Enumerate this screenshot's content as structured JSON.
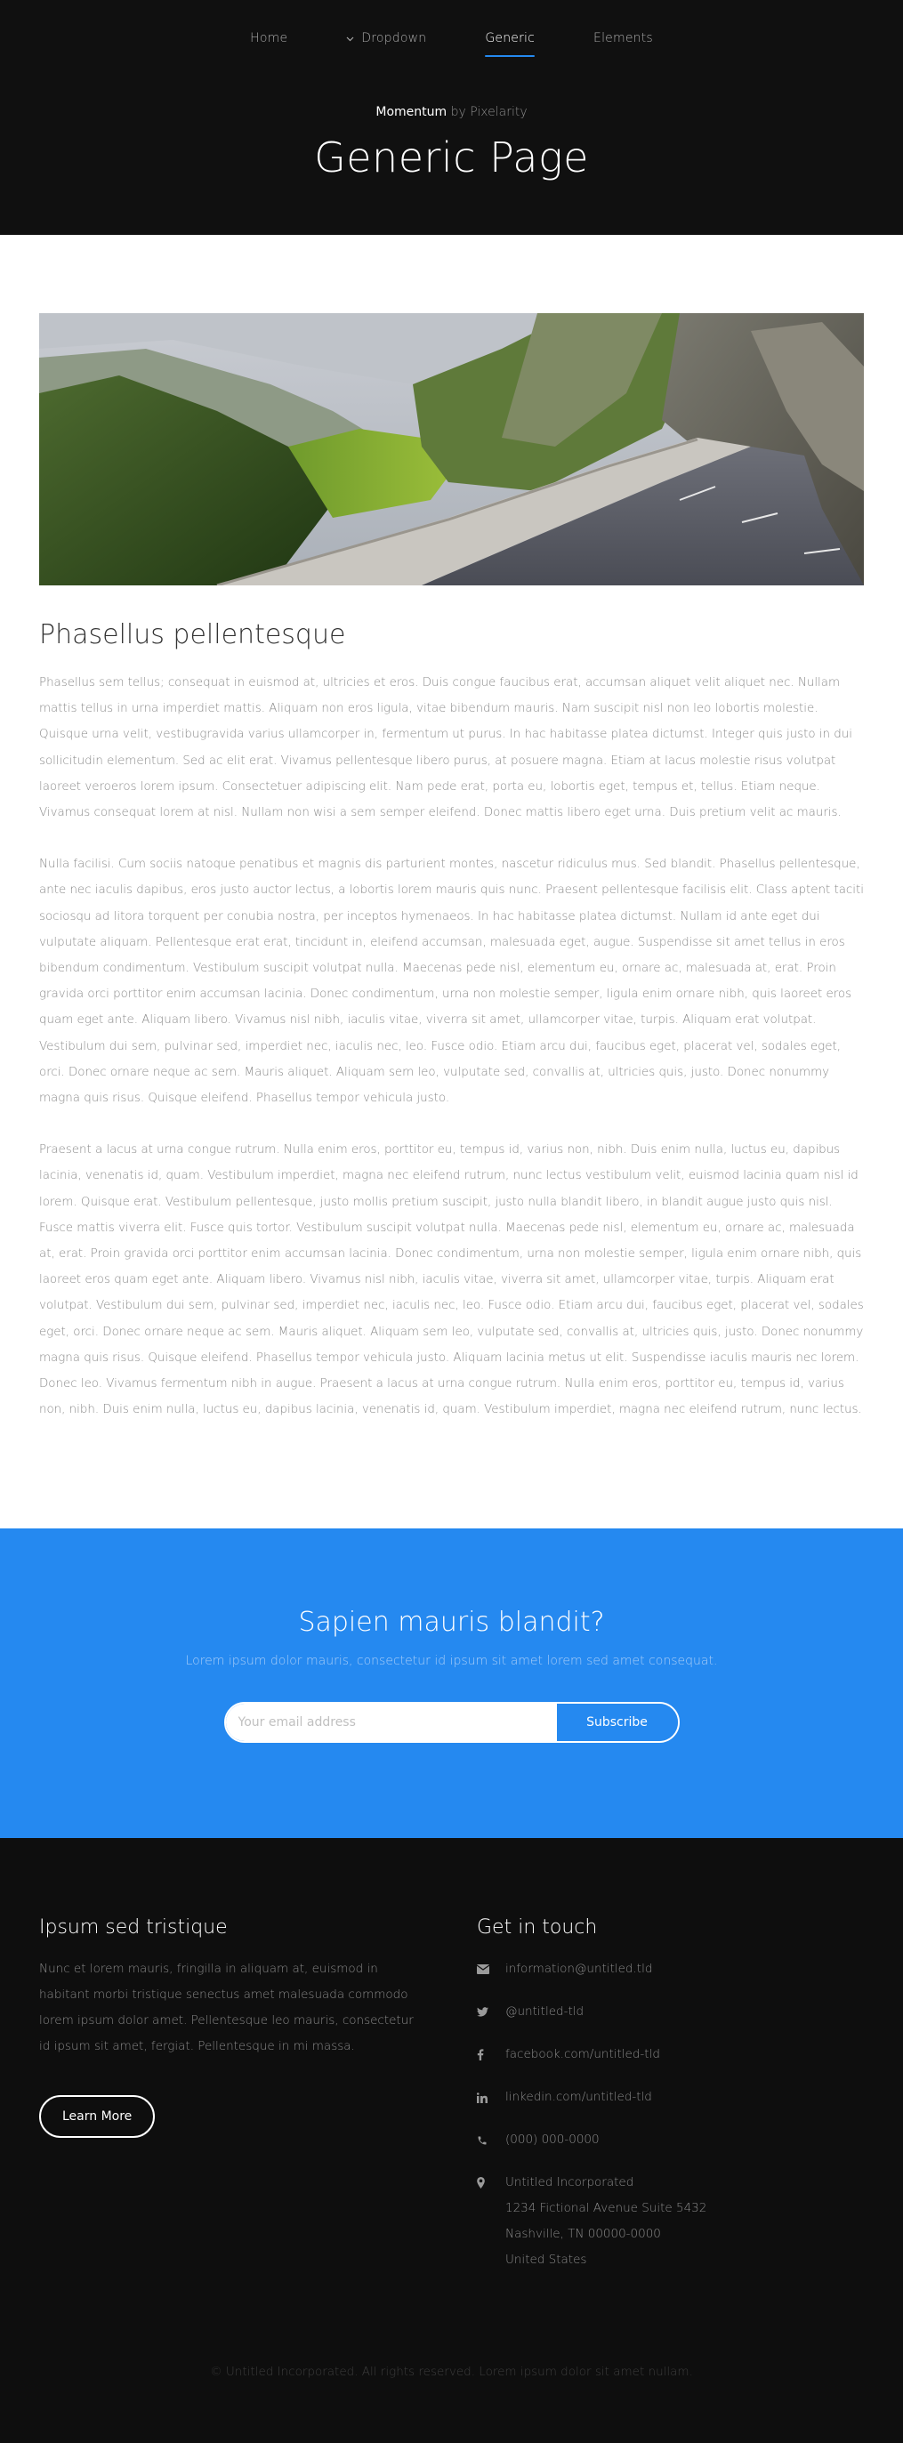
{
  "nav": {
    "items": [
      {
        "label": "Home",
        "active": false
      },
      {
        "label": "Dropdown",
        "active": false,
        "has_chevron": true
      },
      {
        "label": "Generic",
        "active": true
      },
      {
        "label": "Elements",
        "active": false
      }
    ]
  },
  "header": {
    "brand": "Momentum",
    "byline_suffix": "by Pixelarity",
    "title": "Generic Page"
  },
  "main": {
    "image_alt": "mountain road",
    "section_title": "Phasellus pellentesque",
    "paragraphs": [
      "Phasellus sem tellus; consequat in euismod at, ultricies et eros. Duis congue faucibus erat, accumsan aliquet velit aliquet nec. Nullam mattis tellus in urna imperdiet mattis. Aliquam non eros ligula, vitae bibendum mauris. Nam suscipit nisl non leo lobortis molestie. Quisque urna velit, vestibugravida varius ullamcorper in, fermentum ut purus. In hac habitasse platea dictumst. Integer quis justo in dui sollicitudin elementum. Sed ac elit erat. Vivamus pellentesque libero purus, at posuere magna. Etiam at lacus molestie risus volutpat laoreet veroeros lorem ipsum. Consectetuer adipiscing elit. Nam pede erat, porta eu, lobortis eget, tempus et, tellus. Etiam neque. Vivamus consequat lorem at nisl. Nullam non wisi a sem semper eleifend. Donec mattis libero eget urna. Duis pretium velit ac mauris.",
      "Nulla facilisi. Cum sociis natoque penatibus et magnis dis parturient montes, nascetur ridiculus mus. Sed blandit. Phasellus pellentesque, ante nec iaculis dapibus, eros justo auctor lectus, a lobortis lorem mauris quis nunc. Praesent pellentesque facilisis elit. Class aptent taciti sociosqu ad litora torquent per conubia nostra, per inceptos hymenaeos. In hac habitasse platea dictumst. Nullam id ante eget dui vulputate aliquam. Pellentesque erat erat, tincidunt in, eleifend accumsan, malesuada eget, augue. Suspendisse sit amet tellus in eros bibendum condimentum. Vestibulum suscipit volutpat nulla. Maecenas pede nisl, elementum eu, ornare ac, malesuada at, erat. Proin gravida orci porttitor enim accumsan lacinia. Donec condimentum, urna non molestie semper, ligula enim ornare nibh, quis laoreet eros quam eget ante. Aliquam libero. Vivamus nisl nibh, iaculis vitae, viverra sit amet, ullamcorper vitae, turpis. Aliquam erat volutpat. Vestibulum dui sem, pulvinar sed, imperdiet nec, iaculis nec, leo. Fusce odio. Etiam arcu dui, faucibus eget, placerat vel, sodales eget, orci. Donec ornare neque ac sem. Mauris aliquet. Aliquam sem leo, vulputate sed, convallis at, ultricies quis, justo. Donec nonummy magna quis risus. Quisque eleifend. Phasellus tempor vehicula justo.",
      "Praesent a lacus at urna congue rutrum. Nulla enim eros, porttitor eu, tempus id, varius non, nibh. Duis enim nulla, luctus eu, dapibus lacinia, venenatis id, quam. Vestibulum imperdiet, magna nec eleifend rutrum, nunc lectus vestibulum velit, euismod lacinia quam nisl id lorem. Quisque erat. Vestibulum pellentesque, justo mollis pretium suscipit, justo nulla blandit libero, in blandit augue justo quis nisl. Fusce mattis viverra elit. Fusce quis tortor. Vestibulum suscipit volutpat nulla. Maecenas pede nisl, elementum eu, ornare ac, malesuada at, erat. Proin gravida orci porttitor enim accumsan lacinia. Donec condimentum, urna non molestie semper, ligula enim ornare nibh, quis laoreet eros quam eget ante. Aliquam libero. Vivamus nisl nibh, iaculis vitae, viverra sit amet, ullamcorper vitae, turpis. Aliquam erat volutpat. Vestibulum dui sem, pulvinar sed, imperdiet nec, iaculis nec, leo. Fusce odio. Etiam arcu dui, faucibus eget, placerat vel, sodales eget, orci. Donec ornare neque ac sem. Mauris aliquet. Aliquam sem leo, vulputate sed, convallis at, ultricies quis, justo. Donec nonummy magna quis risus. Quisque eleifend. Phasellus tempor vehicula justo. Aliquam lacinia metus ut elit. Suspendisse iaculis mauris nec lorem. Donec leo. Vivamus fermentum nibh in augue. Praesent a lacus at urna congue rutrum. Nulla enim eros, porttitor eu, tempus id, varius non, nibh. Duis enim nulla, luctus eu, dapibus lacinia, venenatis id, quam. Vestibulum imperdiet, magna nec eleifend rutrum, nunc lectus."
    ]
  },
  "cta": {
    "title": "Sapien mauris blandit?",
    "subtitle": "Lorem ipsum dolor mauris, consectetur id ipsum sit amet lorem sed amet consequat.",
    "email_placeholder": "Your email address",
    "subscribe_label": "Subscribe"
  },
  "footer": {
    "left": {
      "heading": "Ipsum sed tristique",
      "text": "Nunc et lorem mauris, fringilla in aliquam at, euismod in habitant morbi tristique senectus amet malesuada commodo lorem ipsum dolor amet. Pellentesque leo mauris, consectetur id ipsum sit amet, fergiat. Pellentesque in mi massa.",
      "button_label": "Learn More"
    },
    "right": {
      "heading": "Get in touch",
      "contacts": [
        {
          "icon": "envelope-icon",
          "lines": [
            "information@untitled.tld"
          ]
        },
        {
          "icon": "twitter-icon",
          "lines": [
            "@untitled-tld"
          ]
        },
        {
          "icon": "facebook-icon",
          "lines": [
            "facebook.com/untitled-tld"
          ]
        },
        {
          "icon": "linkedin-icon",
          "lines": [
            "linkedin.com/untitled-tld"
          ]
        },
        {
          "icon": "phone-icon",
          "lines": [
            "(000) 000-0000"
          ]
        },
        {
          "icon": "map-marker-icon",
          "lines": [
            "Untitled Incorporated",
            "1234 Fictional Avenue Suite 5432",
            "Nashville, TN 00000-0000",
            "United States"
          ]
        }
      ]
    },
    "copyright": "© Untitled Incorporated. All rights reserved. Lorem ipsum dolor sit amet nullam."
  },
  "colors": {
    "accent": "#2589f0",
    "header_bg": "#101010",
    "footer_bg": "#0e0e0e",
    "body_text": "#8a8a8a"
  }
}
